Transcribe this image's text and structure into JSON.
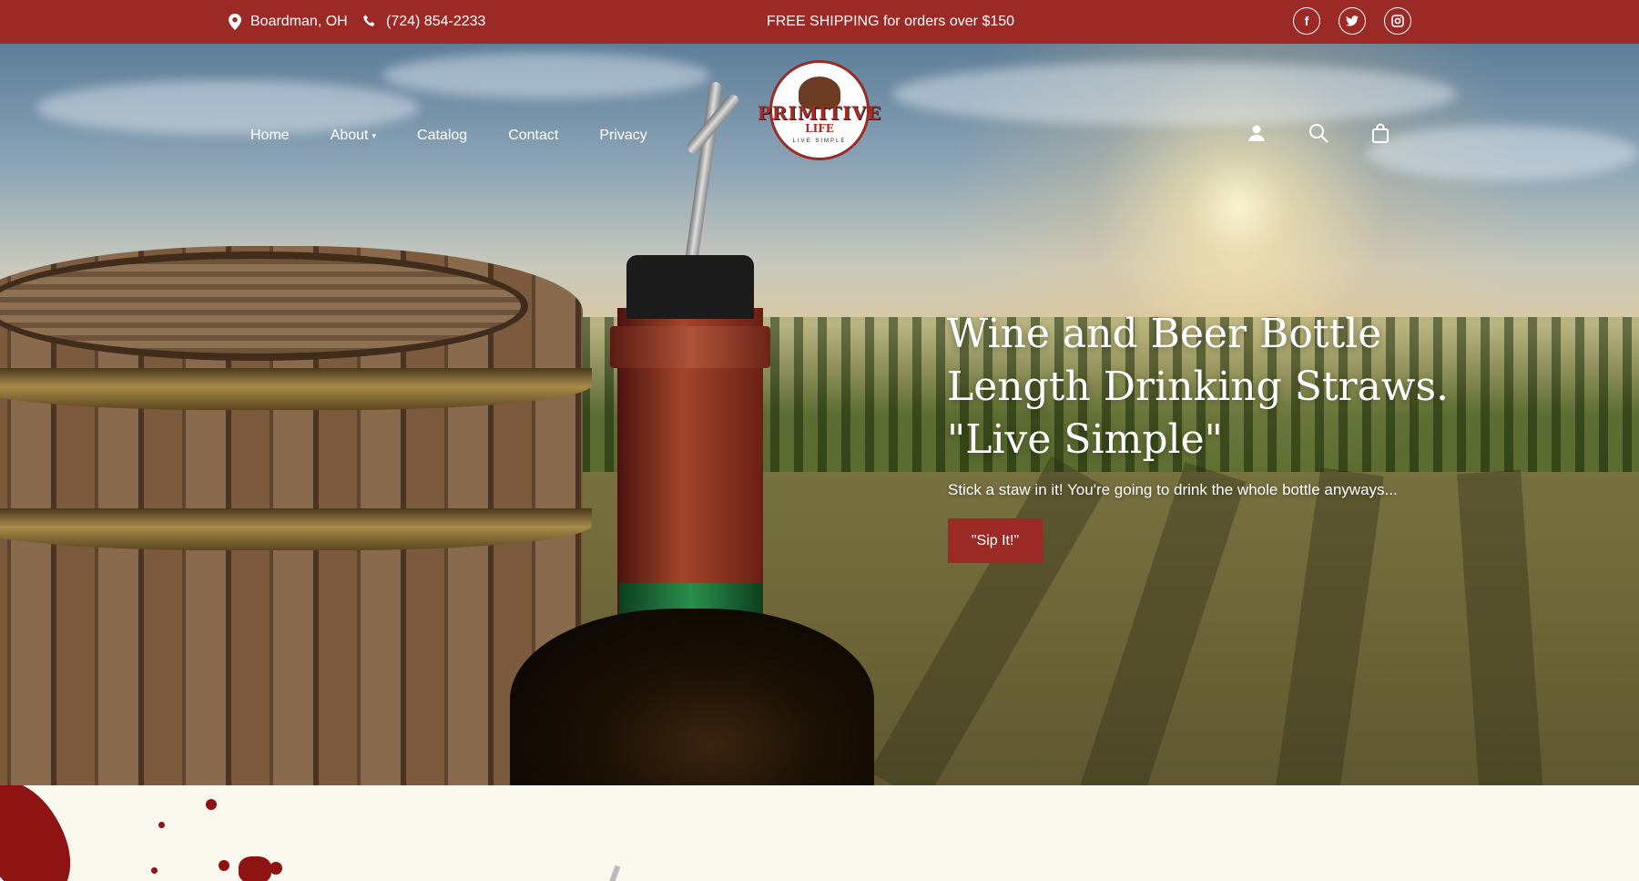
{
  "topbar": {
    "location": "Boardman, OH",
    "phone": "(724) 854-2233",
    "shipping": "FREE SHIPPING for orders over $150",
    "socials": [
      "facebook-icon",
      "twitter-icon",
      "instagram-icon"
    ]
  },
  "nav": {
    "items": [
      {
        "label": "Home"
      },
      {
        "label": "About"
      },
      {
        "label": "Catalog"
      },
      {
        "label": "Contact"
      },
      {
        "label": "Privacy"
      }
    ]
  },
  "logo": {
    "line1": "PRIMITIVE",
    "line2": "LIFE",
    "tagline": "LIVE SIMPLE"
  },
  "hero": {
    "headline_line1": "Wine and Beer Bottle",
    "headline_line2": "Length Drinking Straws.",
    "headline_line3": "\"Live Simple\"",
    "subtitle": "Stick a staw in it! You're going to drink the whole bottle anyways...",
    "cta_label": "\"Sip It!\"",
    "slides_total": 2,
    "active_slide": 1
  },
  "colors": {
    "brand_red": "#9b2a26",
    "cream": "#fbf8ef"
  }
}
